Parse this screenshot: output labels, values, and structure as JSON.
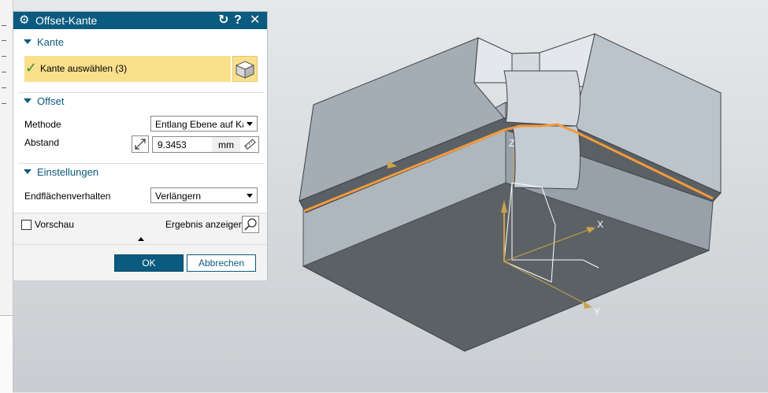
{
  "dialog": {
    "title": "Offset-Kante",
    "title_icons": [
      "gear-icon",
      "reset-icon",
      "help-icon",
      "close-icon"
    ],
    "help_label": "?",
    "close_label": "✕",
    "reset_label": "↻"
  },
  "kante": {
    "header": "Kante",
    "select_label": "Kante auswählen (3)"
  },
  "offset": {
    "header": "Offset",
    "methode_label": "Methode",
    "methode_value": "Entlang Ebene auf Kante",
    "abstand_label": "Abstand",
    "abstand_value": "9.3453",
    "abstand_unit": "mm"
  },
  "einstellungen": {
    "header": "Einstellungen",
    "endflaechen_label": "Endflächenverhalten",
    "endflaechen_value": "Verlängern"
  },
  "preview": {
    "vorschau_label": "Vorschau",
    "vorschau_checked": false,
    "ergebnis_label": "Ergebnis anzeigen"
  },
  "buttons": {
    "ok": "OK",
    "cancel": "Abbrechen"
  },
  "viewport": {
    "axis_x": "X",
    "axis_y": "Y",
    "axis_z": "Z",
    "highlight_color": "#f39a3c",
    "axis_color": "#c9a34c"
  },
  "colors": {
    "accent": "#0b5a7f",
    "selection": "#fbe08c"
  }
}
